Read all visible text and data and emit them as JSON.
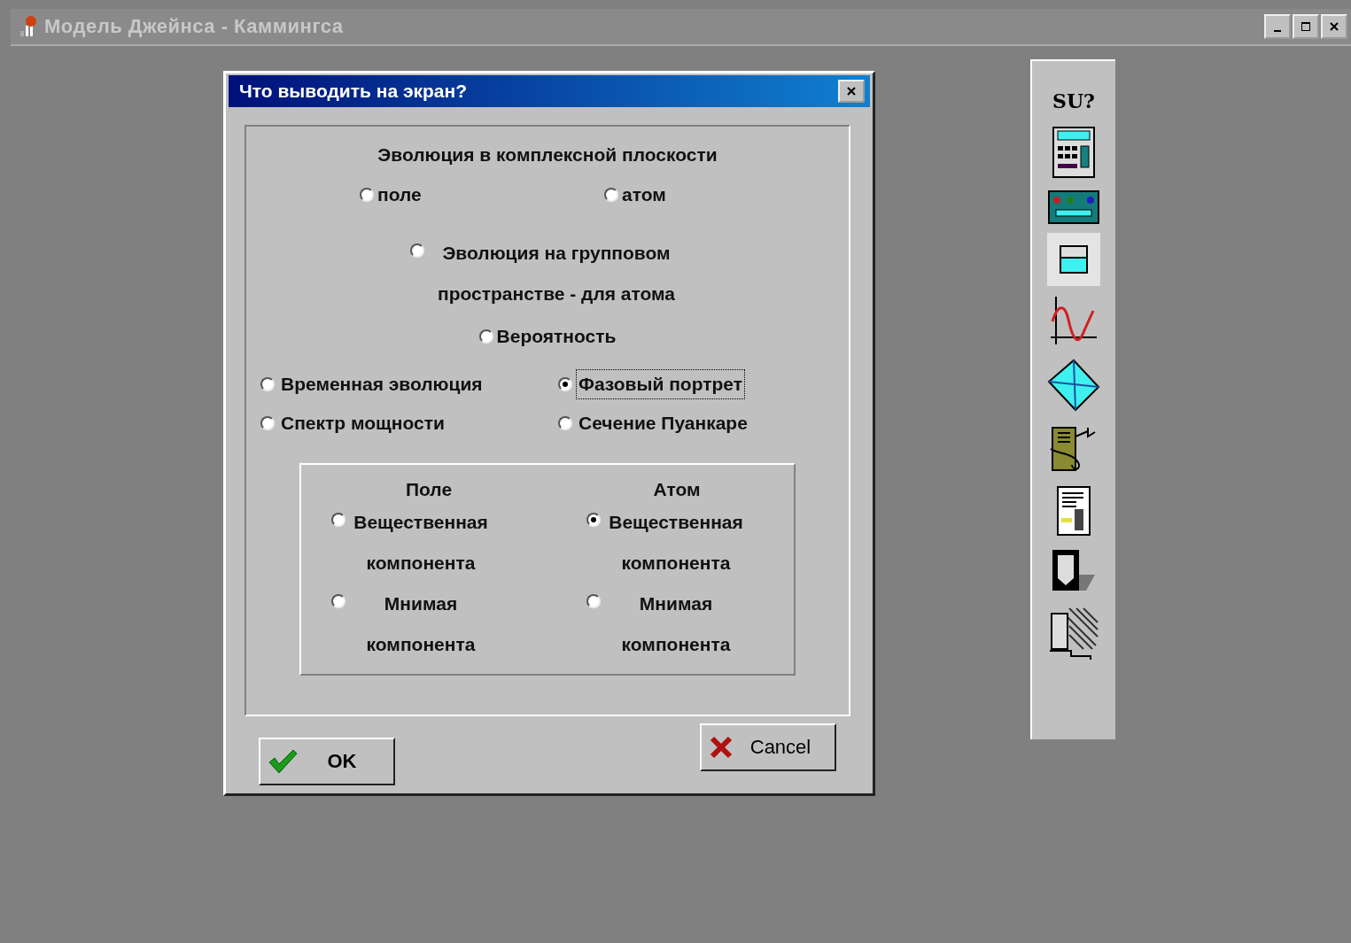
{
  "window": {
    "title": "Модель Джейнса - Каммингса"
  },
  "dialog": {
    "title": "Что выводить на экран?",
    "complex_plane": {
      "heading": "Эволюция в комплексной плоскости",
      "options": [
        {
          "label": "поле",
          "selected": false
        },
        {
          "label": "атом",
          "selected": false
        }
      ]
    },
    "group_space": {
      "label": "Эволюция на групповом пространстве - для атома",
      "selected": false
    },
    "probability": {
      "label": "Вероятность",
      "selected": false
    },
    "views": [
      {
        "label": "Временная эволюция",
        "selected": false,
        "focused": false
      },
      {
        "label": "Фазовый портрет",
        "selected": true,
        "focused": true
      },
      {
        "label": "Спектр мощности",
        "selected": false,
        "focused": false
      },
      {
        "label": "Сечение Пуанкаре",
        "selected": false,
        "focused": false
      }
    ],
    "component_panel": {
      "columns": [
        {
          "heading": "Поле",
          "options": [
            {
              "label": "Вещественная компонента",
              "selected": false
            },
            {
              "label": "Мнимая компонента",
              "selected": false
            }
          ]
        },
        {
          "heading": "Атом",
          "options": [
            {
              "label": "Вещественная компонента",
              "selected": true
            },
            {
              "label": "Мнимая компонента",
              "selected": false
            }
          ]
        }
      ]
    },
    "buttons": [
      {
        "kind": "ok",
        "label": "OK"
      },
      {
        "kind": "cancel",
        "label": "Cancel"
      }
    ]
  },
  "toolbar": {
    "label": "SU?",
    "tools": [
      {
        "kind": "calculator",
        "selected": false
      },
      {
        "kind": "panel",
        "selected": false
      },
      {
        "kind": "window",
        "selected": true
      },
      {
        "kind": "graph",
        "selected": false
      },
      {
        "kind": "diamond",
        "selected": false
      },
      {
        "kind": "device",
        "selected": false
      },
      {
        "kind": "document",
        "selected": false
      },
      {
        "kind": "door-dark",
        "selected": false
      },
      {
        "kind": "door-hatched",
        "selected": false
      }
    ]
  }
}
